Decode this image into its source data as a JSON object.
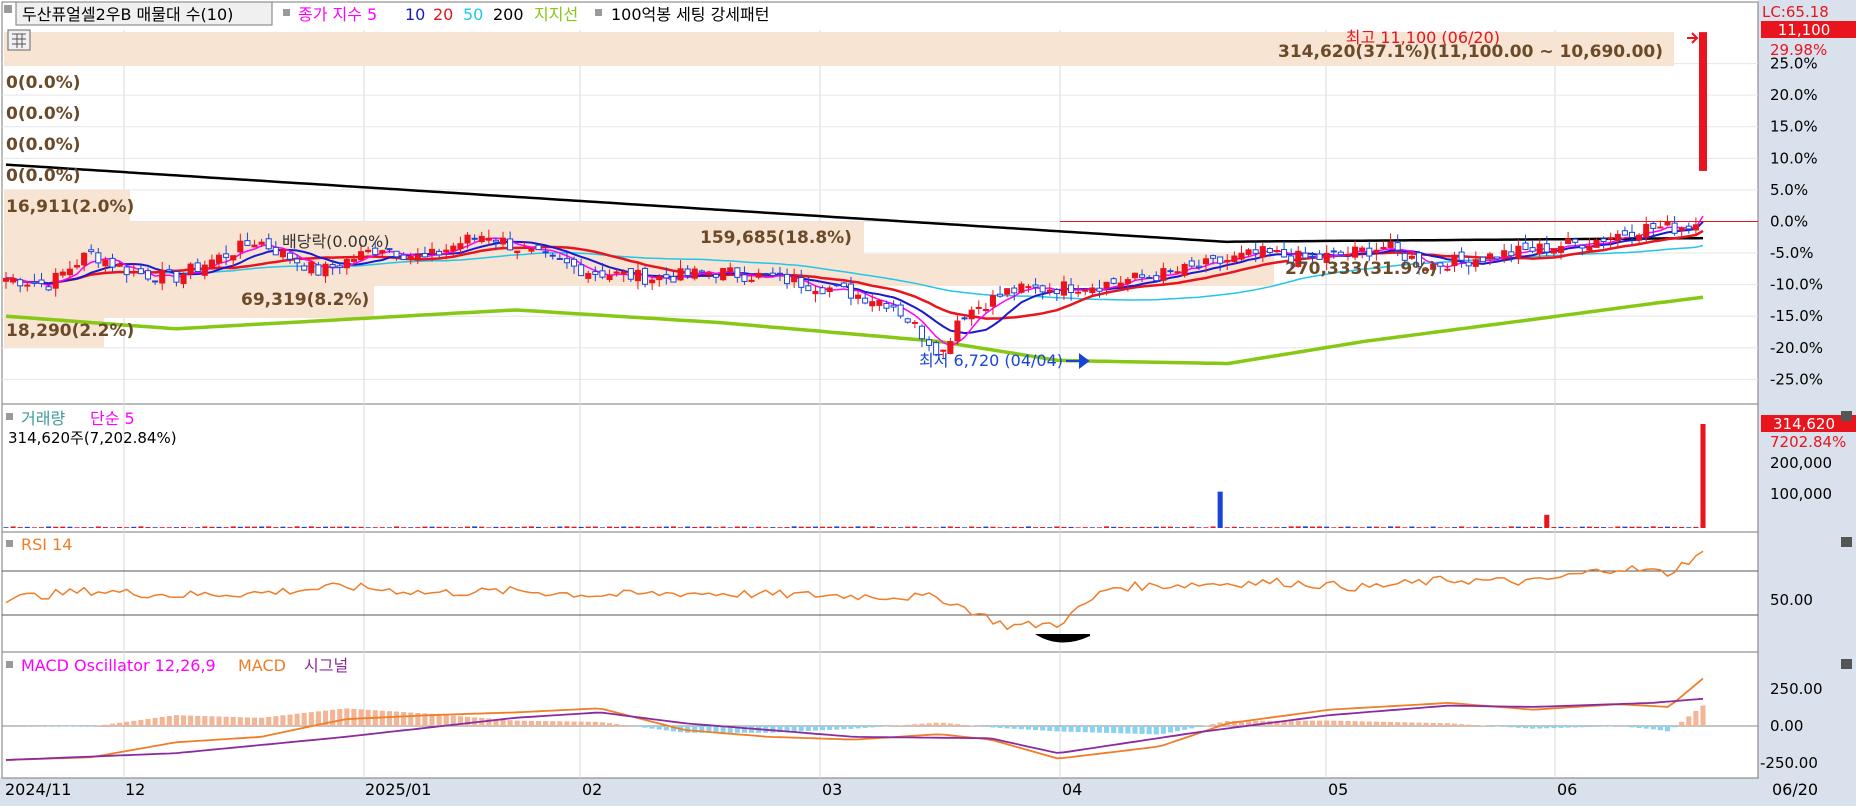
{
  "colors": {
    "up": "#e8141e",
    "down": "#1a44d8",
    "ma5": "#ff00ff",
    "ma10": "#1a1acc",
    "ma20": "#e8141e",
    "ma50": "#22c6e8",
    "ma200": "#000000",
    "support": "#86c814",
    "band": "#f7e4d2",
    "panel_bg": "#d9e1ec",
    "rsi": "#f07d28",
    "macd": "#f07d28",
    "signal": "#8a2ba0",
    "osc_pos": "#f4b496",
    "osc_neg": "#8cd2ee",
    "grid": "#d8d8d8"
  },
  "header": {
    "stock_name": "두산퓨얼셀2우B 매물대 수(10)",
    "ma_label": "종가 지수 5",
    "ma10": "10",
    "ma20": "20",
    "ma50": "50",
    "ma200": "200",
    "support_label": "지지선",
    "pattern_label": "100억봉 세팅 강세패턴",
    "lc": "LC:65.18"
  },
  "price_axis": {
    "last_price": "11,100",
    "last_pct": "29.98%",
    "ticks": [
      "25.0%",
      "20.0%",
      "15.0%",
      "10.0%",
      "5.0%",
      "0.0%",
      "-5.0%",
      "-10.0%",
      "-15.0%",
      "-20.0%",
      "-25.0%"
    ]
  },
  "annotations": {
    "high": "최고 11,100 (06/20)",
    "low": "최저 6,720 (04/04)",
    "dividend": "배당락(0.00%)"
  },
  "volume_profile": [
    "314,620(37.1%)(11,100.00 ~ 10,690.00)",
    "0(0.0%)",
    "0(0.0%)",
    "0(0.0%)",
    "0(0.0%)",
    "16,911(2.0%)",
    "159,685(18.8%)",
    "270,333(31.9%)",
    "69,319(8.2%)",
    "18,290(2.2%)"
  ],
  "volume_panel": {
    "title": "거래량",
    "ma_label": "단순 5",
    "info": "314,620주(7,202.84%)",
    "last": "314,620",
    "last_pct": "7202.84%",
    "ticks": [
      "200,000",
      "100,000"
    ]
  },
  "rsi_panel": {
    "title": "RSI 14",
    "tick": "50.00"
  },
  "macd_panel": {
    "title": "MACD Oscillator 12,26,9",
    "macd_label": "MACD",
    "signal_label": "시그널",
    "ticks": [
      "250.00",
      "0.00",
      "-250.00"
    ]
  },
  "x_axis": [
    "2024/11",
    "12",
    "2025/01",
    "02",
    "03",
    "04",
    "05",
    "06",
    "06/20"
  ],
  "chart_data": {
    "type": "line",
    "title": "두산퓨얼셀2우B",
    "x": [
      "2024/11",
      "12",
      "2025/01",
      "02",
      "03",
      "04",
      "05",
      "06",
      "06/20"
    ],
    "series": [
      {
        "name": "종가 지수 (%)",
        "values": [
          -9,
          -5,
          -5,
          -3,
          -8,
          -9,
          -22,
          -10,
          -7,
          -2,
          29.98
        ]
      },
      {
        "name": "200",
        "values": [
          9,
          6,
          3,
          0,
          -3
        ]
      },
      {
        "name": "지지선",
        "values": [
          -15,
          -17,
          -14,
          -19,
          -22,
          -17,
          -12
        ]
      },
      {
        "name": "거래량",
        "values": [
          314620
        ]
      },
      {
        "name": "RSI 14",
        "values": [
          45,
          52,
          48,
          56,
          50,
          48,
          20,
          55,
          60,
          55,
          75,
          88
        ]
      },
      {
        "name": "MACD",
        "values": [
          -250,
          -100,
          100,
          -20,
          -80,
          -230,
          20,
          180,
          120,
          350
        ]
      }
    ],
    "ylim": [
      -25,
      30
    ],
    "high": {
      "value": 11100,
      "date": "06/20"
    },
    "low": {
      "value": 6720,
      "date": "04/04"
    }
  }
}
